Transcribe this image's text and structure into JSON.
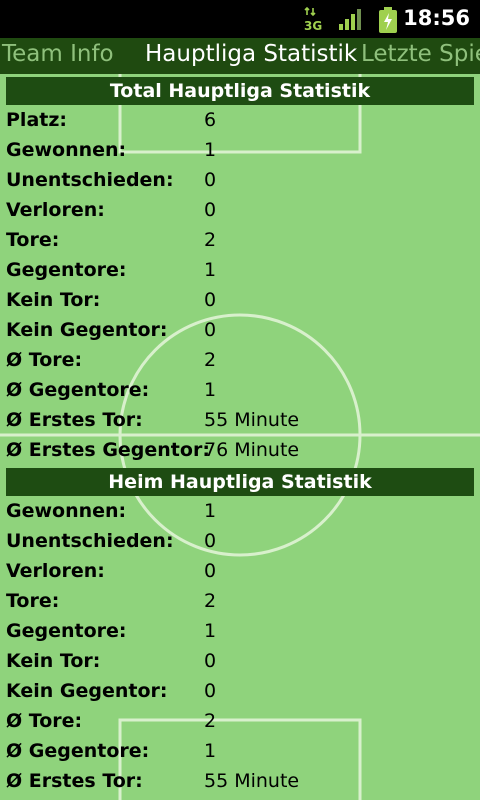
{
  "status_bar": {
    "time": "18:56",
    "network": "3G",
    "icons": [
      "3g-data-icon",
      "signal-icon",
      "battery-charging-icon"
    ]
  },
  "tabs": [
    {
      "label": "Team Info",
      "active": false
    },
    {
      "label": "Hauptliga Statistik",
      "active": true
    },
    {
      "label": "Letzte Spiel",
      "active": false
    }
  ],
  "sections": [
    {
      "title": "Total Hauptliga Statistik",
      "rows": [
        {
          "label": "Platz:",
          "value": "6"
        },
        {
          "label": "Gewonnen:",
          "value": "1"
        },
        {
          "label": "Unentschieden:",
          "value": "0"
        },
        {
          "label": "Verloren:",
          "value": "0"
        },
        {
          "label": "Tore:",
          "value": "2"
        },
        {
          "label": "Gegentore:",
          "value": "1"
        },
        {
          "label": "Kein Tor:",
          "value": "0"
        },
        {
          "label": "Kein Gegentor:",
          "value": "0"
        },
        {
          "label": "Ø Tore:",
          "value": "2"
        },
        {
          "label": "Ø Gegentore:",
          "value": "1"
        },
        {
          "label": "Ø Erstes Tor:",
          "value": "55 Minute"
        },
        {
          "label": "Ø Erstes Gegentor:",
          "value": "76 Minute"
        }
      ]
    },
    {
      "title": "Heim Hauptliga Statistik",
      "rows": [
        {
          "label": "Gewonnen:",
          "value": "1"
        },
        {
          "label": "Unentschieden:",
          "value": "0"
        },
        {
          "label": "Verloren:",
          "value": "0"
        },
        {
          "label": "Tore:",
          "value": "2"
        },
        {
          "label": "Gegentore:",
          "value": "1"
        },
        {
          "label": "Kein Tor:",
          "value": "0"
        },
        {
          "label": "Kein Gegentor:",
          "value": "0"
        },
        {
          "label": "Ø Tore:",
          "value": "2"
        },
        {
          "label": "Ø Gegentore:",
          "value": "1"
        },
        {
          "label": "Ø Erstes Tor:",
          "value": "55 Minute"
        }
      ]
    }
  ],
  "colors": {
    "background": "#8fd37c",
    "header": "#1e4c12",
    "tabbar": "#1f4a10",
    "field_lines": "#d8f0cc"
  }
}
